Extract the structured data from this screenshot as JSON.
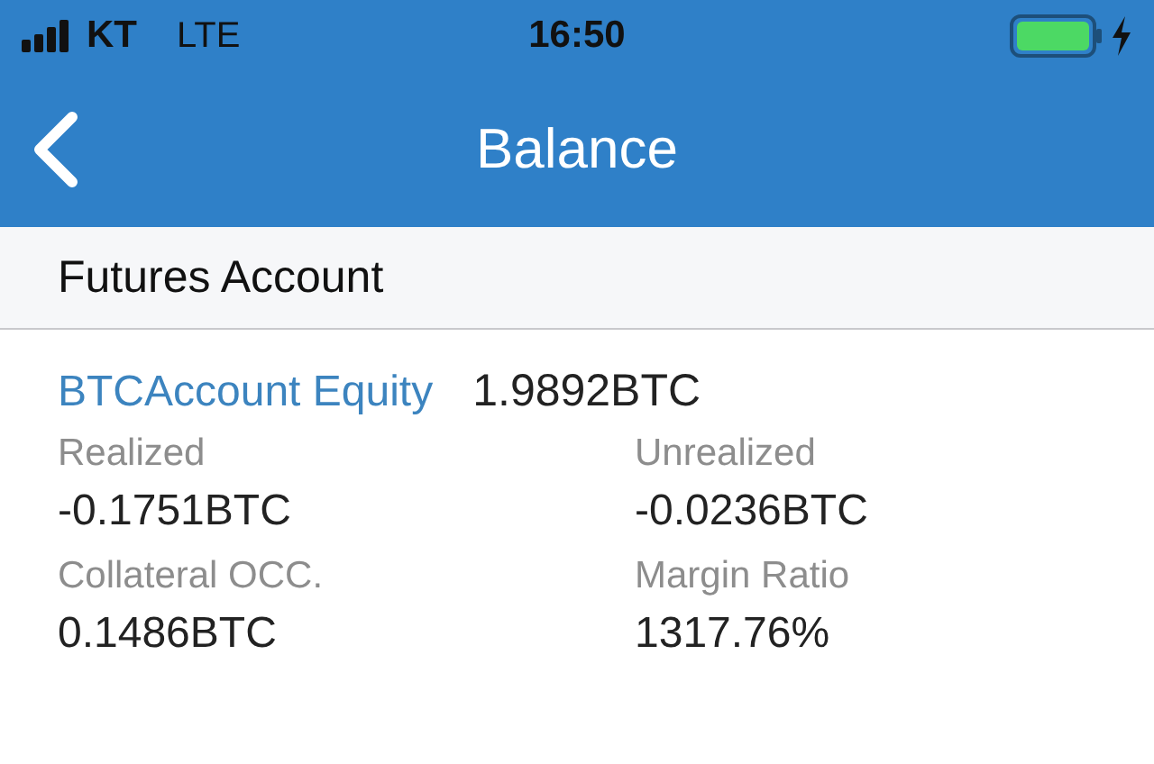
{
  "status_bar": {
    "carrier": "KT",
    "network": "LTE",
    "time": "16:50"
  },
  "nav_bar": {
    "title": "Balance"
  },
  "section": {
    "title": "Futures Account"
  },
  "equity": {
    "label": "BTCAccount Equity",
    "value": "1.9892BTC"
  },
  "stats": [
    {
      "label": "Realized",
      "value": "-0.1751BTC"
    },
    {
      "label": "Unrealized",
      "value": "-0.0236BTC"
    },
    {
      "label": "Collateral OCC.",
      "value": "0.1486BTC"
    },
    {
      "label": "Margin Ratio",
      "value": "1317.76%"
    }
  ]
}
